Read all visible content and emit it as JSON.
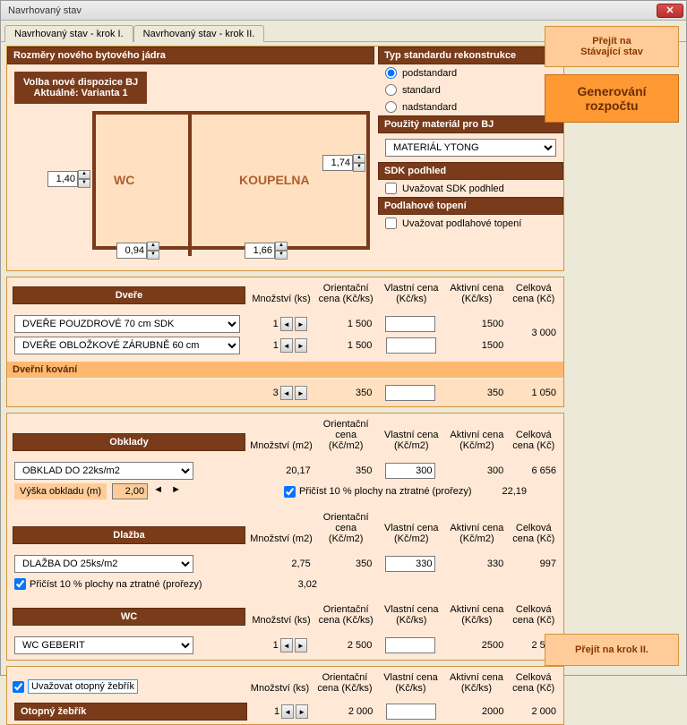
{
  "window": {
    "title": "Navrhovaný stav"
  },
  "tabs": [
    {
      "label": "Navrhovaný stav - krok I.",
      "active": true
    },
    {
      "label": "Navrhovaný stav - krok II.",
      "active": false
    }
  ],
  "buttons": {
    "prejit_stavajici": "Přejít na\nStávající stav",
    "generovani": "Generování rozpočtu",
    "prejit_krok2": "Přejít na krok II."
  },
  "rozmery": {
    "header": "Rozměry nového bytového jádra",
    "dispo_line1": "Volba nové dispozice BJ",
    "dispo_line2": "Aktuálně: Varianta 1",
    "dim_left": "1,40",
    "dim_right": "1,74",
    "dim_bl": "0,94",
    "dim_br": "1,66",
    "wc": "WC",
    "koupelna": "KOUPELNA"
  },
  "typ_standard": {
    "header": "Typ standardu rekonstrukce",
    "opt1": "podstandard",
    "opt2": "standard",
    "opt3": "nadstandard"
  },
  "material": {
    "header": "Použitý materiál pro BJ",
    "value": "MATERIÁL YTONG"
  },
  "sdk": {
    "header": "SDK podhled",
    "check": "Uvažovat SDK podhled"
  },
  "podlah": {
    "header": "Podlahové topení",
    "check": "Uvažovat podlahové topení"
  },
  "cols": {
    "mnoz_ks": "Množství (ks)",
    "mnoz_m2": "Množství (m2)",
    "or_ks": "Orientační cena (Kč/ks)",
    "or_m2": "Orientační cena (Kč/m2)",
    "vl_ks": "Vlastní cena (Kč/ks)",
    "vl_m2": "Vlastní cena (Kč/m2)",
    "ak_ks": "Aktivní cena (Kč/ks)",
    "ak_m2": "Aktivní cena (Kč/m2)",
    "ce": "Celková cena (Kč)"
  },
  "dvere": {
    "header": "Dveře",
    "row1": {
      "label": "DVEŘE POUZDROVÉ 70 cm SDK",
      "qty": "1",
      "or": "1 500",
      "ak": "1500"
    },
    "row2": {
      "label": "DVEŘE OBLOŽKOVÉ ZÁRUBNĚ 60 cm",
      "qty": "1",
      "or": "1 500",
      "ak": "1500"
    },
    "total": "3 000",
    "kovani_header": "Dveřní kování",
    "kovani": {
      "qty": "3",
      "or": "350",
      "ak": "350",
      "ce": "1 050"
    }
  },
  "obklady": {
    "header": "Obklady",
    "select": "OBKLAD DO 22ks/m2",
    "vyska_label": "Výška obkladu (m)",
    "vyska_val": "2,00",
    "qty": "20,17",
    "or": "350",
    "vl": "300",
    "ak": "300",
    "ce": "6 656",
    "pricist": "Přičíst 10 % plochy na ztratné (prořezy)",
    "pricist_val": "22,19"
  },
  "dlazba": {
    "header": "Dlažba",
    "select": "DLAŽBA DO 25ks/m2",
    "qty": "2,75",
    "qty2": "3,02",
    "or": "350",
    "vl": "330",
    "ak": "330",
    "ce": "997",
    "pricist": "Přičíst 10 % plochy na ztratné (prořezy)"
  },
  "wc": {
    "header": "WC",
    "select": "WC GEBERIT",
    "qty": "1",
    "or": "2 500",
    "ak": "2500",
    "ce": "2 500"
  },
  "zebrik": {
    "check": "Uvažovat otopný žebřík",
    "header": "Otopný žebřík",
    "qty": "1",
    "or": "2 000",
    "ak": "2000",
    "ce": "2 000"
  }
}
